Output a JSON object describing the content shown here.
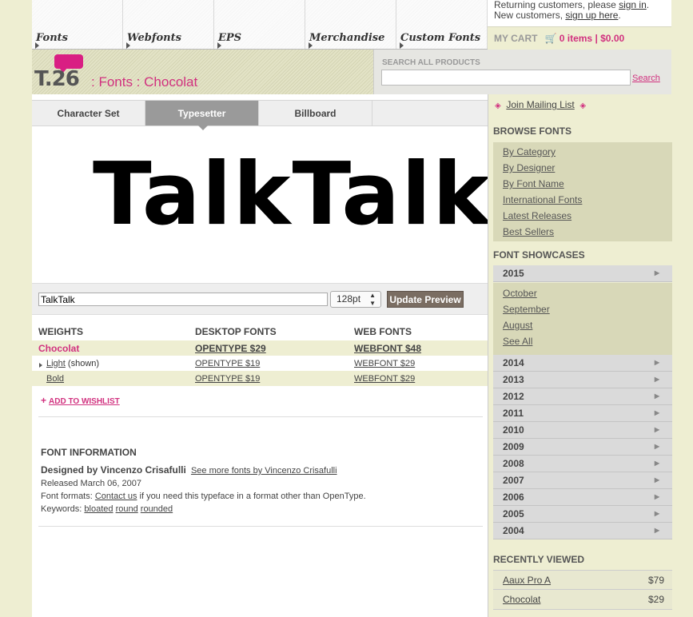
{
  "nav": {
    "tabs": [
      {
        "label": "Fonts"
      },
      {
        "label": "Webfonts"
      },
      {
        "label": "EPS"
      },
      {
        "label": "Merchandise"
      },
      {
        "label": "Custom Fonts"
      }
    ]
  },
  "account": {
    "returning_prefix": "Returning customers, please ",
    "sign_in": "sign in",
    "returning_suffix": ".",
    "new_prefix": "New customers, ",
    "sign_up": "sign up here",
    "new_suffix": "."
  },
  "cart": {
    "label": "MY CART",
    "value": "0 items | $0.00"
  },
  "brand": {
    "logo": "T.26",
    "breadcrumb": ": Fonts : Chocolat"
  },
  "search": {
    "label": "SEARCH ALL PRODUCTS",
    "value": "",
    "button": "Search"
  },
  "subtabs": [
    {
      "label": "Character Set",
      "active": false
    },
    {
      "label": "Typesetter",
      "active": true
    },
    {
      "label": "Billboard",
      "active": false
    }
  ],
  "preview": {
    "text": "TalkTalk"
  },
  "controls": {
    "input_value": "TalkTalk",
    "size": "128pt",
    "update": "Update Preview"
  },
  "weights": {
    "headers": {
      "weights": "WEIGHTS",
      "desktop": "DESKTOP FONTS",
      "web": "WEB FONTS"
    },
    "family": {
      "name": "Chocolat",
      "desktop": "OPENTYPE $29",
      "web": "WEBFONT $48"
    },
    "rows": [
      {
        "name": "Light",
        "note": " (shown)",
        "desktop": "OPENTYPE $19",
        "web": "WEBFONT $29"
      },
      {
        "name": "Bold",
        "note": "",
        "desktop": "OPENTYPE $19",
        "web": "WEBFONT $29"
      }
    ]
  },
  "wishlist": {
    "label": "ADD TO WISHLIST"
  },
  "info": {
    "heading": "FONT INFORMATION",
    "designed_by": "Designed by Vincenzo Crisafulli",
    "more_link": "See more fonts by Vincenzo Crisafulli",
    "released": "Released March 06, 2007",
    "formats_prefix": "Font formats: ",
    "contact": "Contact us",
    "formats_suffix": " if you need this typeface in a format other than OpenType.",
    "keywords_prefix": "Keywords: ",
    "keywords": [
      "bloated",
      "round",
      "rounded"
    ]
  },
  "sidebar": {
    "mailing": "Join Mailing List",
    "browse_heading": "BROWSE FONTS",
    "browse": [
      "By Category",
      "By Designer",
      "By Font Name",
      "International Fonts",
      "Latest Releases",
      "Best Sellers"
    ],
    "showcase_heading": "FONT SHOWCASES",
    "year_open": "2015",
    "year_open_items": [
      "October",
      "September",
      "August",
      "See All"
    ],
    "years": [
      "2014",
      "2013",
      "2012",
      "2011",
      "2010",
      "2009",
      "2008",
      "2007",
      "2006",
      "2005",
      "2004"
    ],
    "recent_heading": "RECENTLY VIEWED",
    "recent": [
      {
        "name": "Aaux Pro A",
        "price": "$79"
      },
      {
        "name": "Chocolat",
        "price": "$29"
      }
    ]
  }
}
